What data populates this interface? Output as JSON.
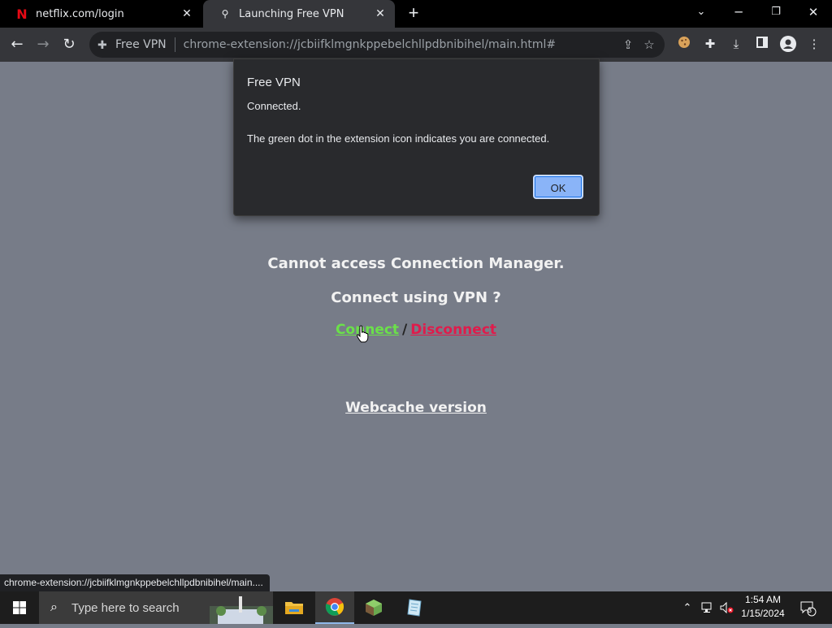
{
  "browser": {
    "tabs": [
      {
        "title": "netflix.com/login",
        "favicon": "netflix-icon"
      },
      {
        "title": "Launching Free VPN",
        "favicon": "vpn-extension-icon"
      }
    ],
    "origin_chip": "Free VPN",
    "url": "chrome-extension://jcbiifklmgnkppebelchllpdbnibihel/main.html#"
  },
  "dialog": {
    "title": "Free VPN",
    "line1": "Connected.",
    "line2": "The green dot in the extension icon indicates you are connected.",
    "ok_label": "OK"
  },
  "page": {
    "message1": "Cannot access Connection Manager.",
    "message2": "Connect using VPN ?",
    "connect_label": "Connect",
    "separator": "/",
    "disconnect_label": "Disconnect",
    "webcache_label": "Webcache version"
  },
  "status_bubble": "chrome-extension://jcbiifklmgnkppebelchllpdbnibihel/main....",
  "taskbar": {
    "search_placeholder": "Type here to search",
    "time": "1:54 AM",
    "date": "1/15/2024",
    "notification_count": "3"
  },
  "colors": {
    "page_bg": "#777c88",
    "connect": "#6be04a",
    "disconnect": "#e01b4b",
    "ok_button": "#8ab4f8"
  }
}
